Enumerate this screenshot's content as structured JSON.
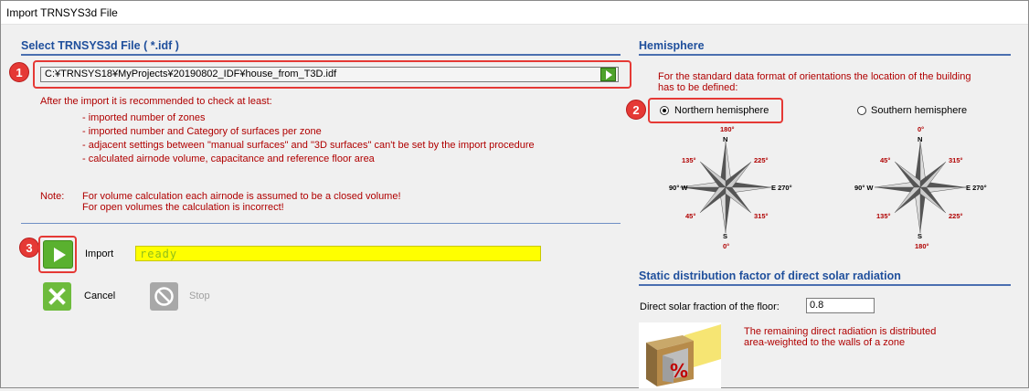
{
  "window": {
    "title": "Import TRNSYS3d File"
  },
  "file_section": {
    "header": "Select TRNSYS3d File ( *.idf )",
    "file_path": "C:¥TRNSYS18¥MyProjects¥20190802_IDF¥house_from_T3D.idf",
    "recommend_intro": "After the import it is recommended to check at least:",
    "bullets": [
      "- imported number of zones",
      "- imported number and Category of surfaces per zone",
      "- adjacent settings between \"manual surfaces\" and \"3D surfaces\" can't be set by the import procedure",
      "- calculated airnode volume, capacitance and reference floor area"
    ],
    "note_label": "Note:",
    "note_line1": "For volume calculation each airnode is assumed to be a closed volume!",
    "note_line2": "For open volumes the calculation is incorrect!"
  },
  "actions": {
    "import_label": "Import",
    "status_text": "ready",
    "cancel_label": "Cancel",
    "stop_label": "Stop"
  },
  "hemisphere": {
    "header": "Hemisphere",
    "desc_line1": "For the standard data format of orientations the location of the  building",
    "desc_line2": "has to be defined:",
    "northern_label": "Northern hemisphere",
    "southern_label": "Southern hemisphere",
    "selected": "northern",
    "north_compass": {
      "top_deg": "180°",
      "top": "N",
      "ne_deg": "225°",
      "nw_deg": "135°",
      "west": "90° W",
      "east": "E 270°",
      "sw_deg": "45°",
      "se_deg": "315°",
      "bottom": "S",
      "bottom_deg": "0°"
    },
    "south_compass": {
      "top_deg": "0°",
      "top": "N",
      "ne_deg": "315°",
      "nw_deg": "45°",
      "west": "90° W",
      "east": "E 270°",
      "sw_deg": "135°",
      "se_deg": "225°",
      "bottom": "S",
      "bottom_deg": "180°"
    }
  },
  "solar": {
    "header": "Static distribution factor of direct solar radiation",
    "fraction_label": "Direct solar fraction of the floor:",
    "fraction_value": "0.8",
    "desc_line1": "The remaining direct radiation is  distributed",
    "desc_line2": "area-weighted to the walls of a zone",
    "img_symbol": "%"
  },
  "callouts": [
    "1",
    "2",
    "3"
  ],
  "colors": {
    "header_blue": "#1f4f9c",
    "note_red": "#b00000",
    "status_yellow": "#ffff00",
    "callout_red": "#e53935"
  }
}
